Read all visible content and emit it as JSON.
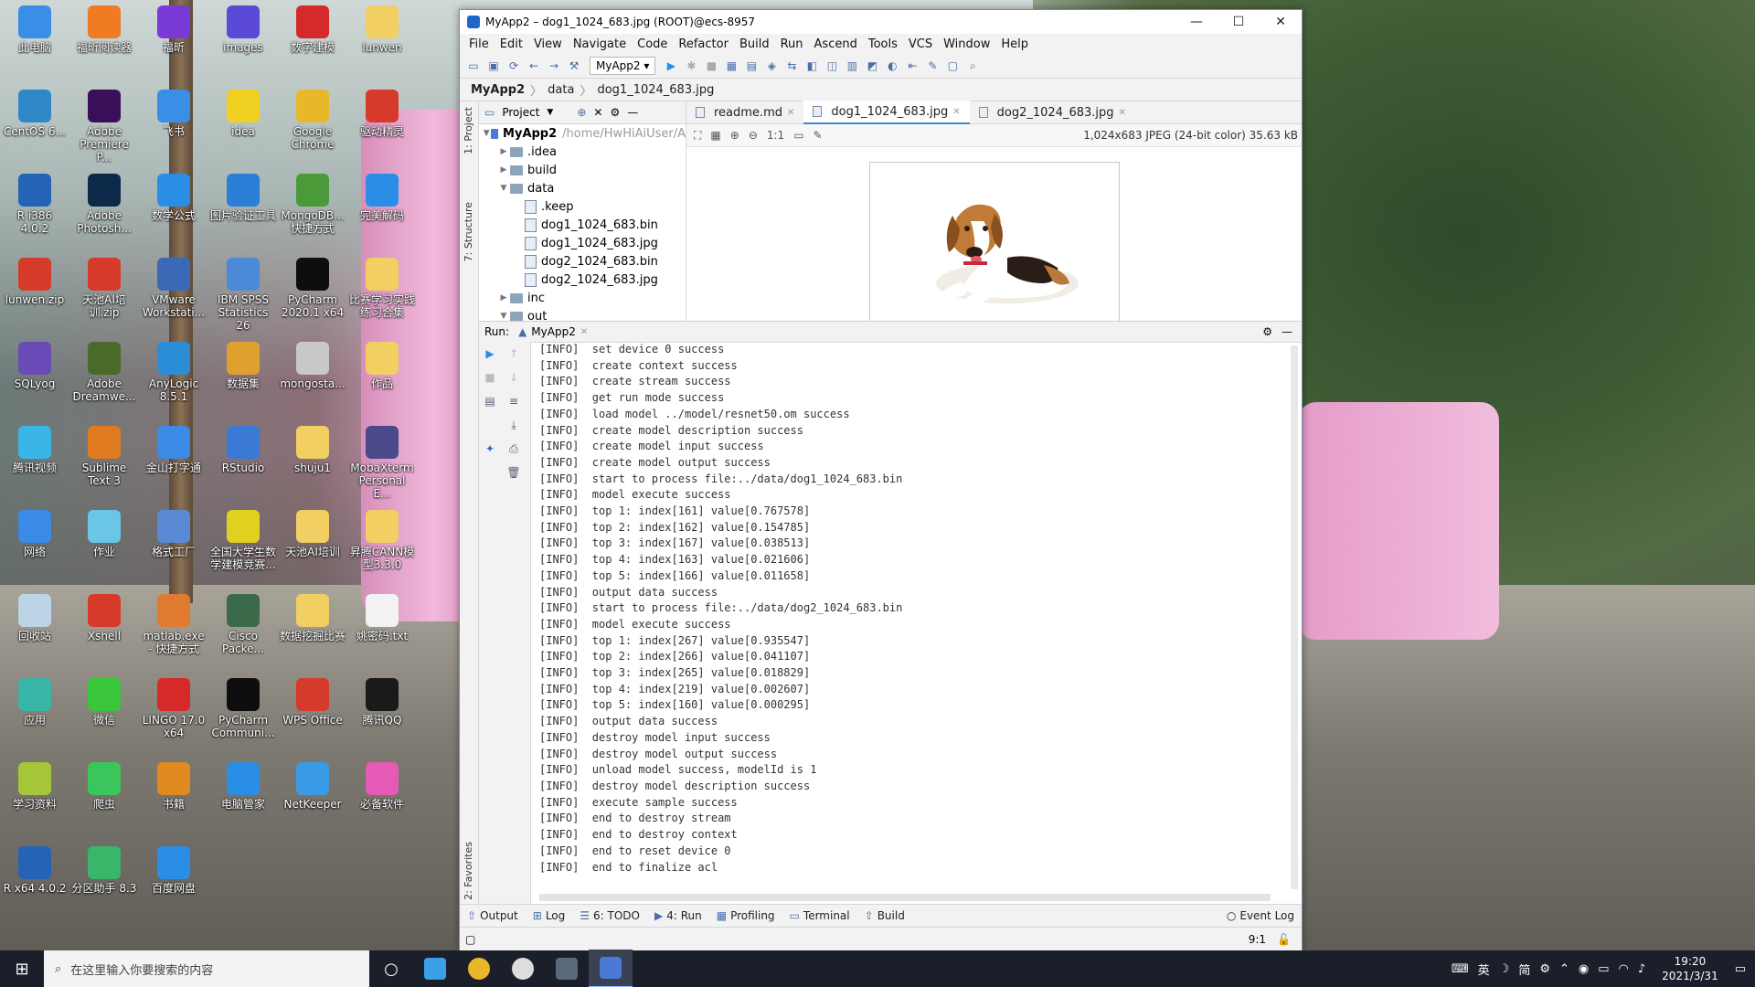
{
  "desktop_icons": [
    {
      "label": "此电脑",
      "color": "#3a8ee6"
    },
    {
      "label": "福昕阅读器",
      "color": "#f07b22"
    },
    {
      "label": "福昕",
      "color": "#7a3ad6"
    },
    {
      "label": "images",
      "color": "#5a4ad6"
    },
    {
      "label": "数字建模",
      "color": "#d62a2a"
    },
    {
      "label": "lunwen",
      "color": "#f2cf62"
    },
    {
      "label": "CentOS 6...",
      "color": "#2f89c9"
    },
    {
      "label": "Adobe Premiere P...",
      "color": "#3a0f5a"
    },
    {
      "label": "飞书",
      "color": "#3a8ee6"
    },
    {
      "label": "idea",
      "color": "#f0d020"
    },
    {
      "label": "Google Chrome",
      "color": "#e9b82a"
    },
    {
      "label": "驱动精灵",
      "color": "#d63a2a"
    },
    {
      "label": "R i386 4.0.2",
      "color": "#2463b5"
    },
    {
      "label": "Adobe Photosh...",
      "color": "#0d2a4a"
    },
    {
      "label": "数学公式",
      "color": "#2a8ee6"
    },
    {
      "label": "图片验证工具",
      "color": "#2a7ed6"
    },
    {
      "label": "MongoDB... 快捷方式",
      "color": "#4a9a3a"
    },
    {
      "label": "完美解码",
      "color": "#2a8ee6"
    },
    {
      "label": "lunwen.zip",
      "color": "#d63a2a"
    },
    {
      "label": "天池AI培训.zip",
      "color": "#d63a2a"
    },
    {
      "label": "VMware Workstati...",
      "color": "#3a6ab6"
    },
    {
      "label": "IBM SPSS Statistics 26",
      "color": "#4a8ad6"
    },
    {
      "label": "PyCharm 2020.1 x64",
      "color": "#0e0e0e"
    },
    {
      "label": "比赛学习实践练习合集",
      "color": "#f2cf62"
    },
    {
      "label": "SQLyog",
      "color": "#6a4ab6"
    },
    {
      "label": "Adobe Dreamwe...",
      "color": "#4a6a2a"
    },
    {
      "label": "AnyLogic 8.5.1",
      "color": "#2a8ed6"
    },
    {
      "label": "数据集",
      "color": "#e0a030"
    },
    {
      "label": "mongosta...",
      "color": "#c8c8c8"
    },
    {
      "label": "作品",
      "color": "#f2cf62"
    },
    {
      "label": "腾讯视频",
      "color": "#3ab6e6"
    },
    {
      "label": "Sublime Text 3",
      "color": "#e07a20"
    },
    {
      "label": "金山打字通",
      "color": "#3a8ae6"
    },
    {
      "label": "RStudio",
      "color": "#3a7ad6"
    },
    {
      "label": "shuju1",
      "color": "#f2cf62"
    },
    {
      "label": "MobaXterm Personal E...",
      "color": "#4a4a8a"
    },
    {
      "label": "网络",
      "color": "#3a8ae6"
    },
    {
      "label": "作业",
      "color": "#6ac6e6"
    },
    {
      "label": "格式工厂",
      "color": "#5a8ad6"
    },
    {
      "label": "全国大学生数学建模竞赛...",
      "color": "#e0d020"
    },
    {
      "label": "天池AI培训",
      "color": "#f2cf62"
    },
    {
      "label": "昇腾CANN模型3.3.0",
      "color": "#f2cf62"
    },
    {
      "label": "回收站",
      "color": "#bcd4e6"
    },
    {
      "label": "Xshell",
      "color": "#d63a2a"
    },
    {
      "label": "matlab.exe - 快捷方式",
      "color": "#e07a30"
    },
    {
      "label": "Cisco Packe...",
      "color": "#3a6a4a"
    },
    {
      "label": "数据挖掘比赛",
      "color": "#f2cf62"
    },
    {
      "label": "姚密码.txt",
      "color": "#f2f2f2"
    },
    {
      "label": "应用",
      "color": "#3ab6a6"
    },
    {
      "label": "微信",
      "color": "#3ac63a"
    },
    {
      "label": "LINGO 17.0 x64",
      "color": "#d62a2a"
    },
    {
      "label": "PyCharm Communi...",
      "color": "#0e0e0e"
    },
    {
      "label": "WPS Office",
      "color": "#d63a2a"
    },
    {
      "label": "腾讯QQ",
      "color": "#1a1a1a"
    },
    {
      "label": "学习资料",
      "color": "#a6c63a"
    },
    {
      "label": "爬虫",
      "color": "#3ac65a"
    },
    {
      "label": "书籍",
      "color": "#e08a20"
    },
    {
      "label": "电脑管家",
      "color": "#2a8ee6"
    },
    {
      "label": "NetKeeper",
      "color": "#3a9ae6"
    },
    {
      "label": "必备软件",
      "color": "#e65ab6"
    },
    {
      "label": "R x64 4.0.2",
      "color": "#2463b5"
    },
    {
      "label": "分区助手 8.3",
      "color": "#3ab66a"
    },
    {
      "label": "百度网盘",
      "color": "#2a8ee6"
    }
  ],
  "window": {
    "title": "MyApp2 – dog1_1024_683.jpg (ROOT)@ecs-8957",
    "minimize": "—",
    "maximize": "☐",
    "close": "✕"
  },
  "menu": [
    "File",
    "Edit",
    "View",
    "Navigate",
    "Code",
    "Refactor",
    "Build",
    "Run",
    "Ascend",
    "Tools",
    "VCS",
    "Window",
    "Help"
  ],
  "run_config": "MyApp2",
  "breadcrumb": [
    "MyApp2",
    "data",
    "dog1_1024_683.jpg"
  ],
  "project_panel": {
    "title": "Project",
    "tree": [
      {
        "label": "MyApp2",
        "extra": "/home/HwHiAiUser/A",
        "depth": 0,
        "kind": "root",
        "arrow": "▼"
      },
      {
        "label": ".idea",
        "depth": 1,
        "kind": "folder",
        "arrow": "▶"
      },
      {
        "label": "build",
        "depth": 1,
        "kind": "folder",
        "arrow": "▶"
      },
      {
        "label": "data",
        "depth": 1,
        "kind": "folder",
        "arrow": "▼"
      },
      {
        "label": ".keep",
        "depth": 2,
        "kind": "file",
        "arrow": ""
      },
      {
        "label": "dog1_1024_683.bin",
        "depth": 2,
        "kind": "file",
        "arrow": ""
      },
      {
        "label": "dog1_1024_683.jpg",
        "depth": 2,
        "kind": "file",
        "arrow": ""
      },
      {
        "label": "dog2_1024_683.bin",
        "depth": 2,
        "kind": "file",
        "arrow": ""
      },
      {
        "label": "dog2_1024_683.jpg",
        "depth": 2,
        "kind": "file",
        "arrow": ""
      },
      {
        "label": "inc",
        "depth": 1,
        "kind": "folder",
        "arrow": "▶"
      },
      {
        "label": "out",
        "depth": 1,
        "kind": "folder",
        "arrow": "▼"
      }
    ]
  },
  "left_strip": [
    "1: Project",
    "7: Structure",
    "2: Favorites"
  ],
  "tabs": [
    {
      "label": "readme.md",
      "active": false
    },
    {
      "label": "dog1_1024_683.jpg",
      "active": true
    },
    {
      "label": "dog2_1024_683.jpg",
      "active": false
    }
  ],
  "image_info": "1,024x683 JPEG (24-bit color) 35.63 kB",
  "zoom_label": "1:1",
  "run_panel": {
    "label": "Run:",
    "tab": "MyApp2",
    "lines": [
      "[INFO]  set device 0 success",
      "[INFO]  create context success",
      "[INFO]  create stream success",
      "[INFO]  get run mode success",
      "[INFO]  load model ../model/resnet50.om success",
      "[INFO]  create model description success",
      "[INFO]  create model input success",
      "[INFO]  create model output success",
      "[INFO]  start to process file:../data/dog1_1024_683.bin",
      "[INFO]  model execute success",
      "[INFO]  top 1: index[161] value[0.767578]",
      "[INFO]  top 2: index[162] value[0.154785]",
      "[INFO]  top 3: index[167] value[0.038513]",
      "[INFO]  top 4: index[163] value[0.021606]",
      "[INFO]  top 5: index[166] value[0.011658]",
      "[INFO]  output data success",
      "[INFO]  start to process file:../data/dog2_1024_683.bin",
      "[INFO]  model execute success",
      "[INFO]  top 1: index[267] value[0.935547]",
      "[INFO]  top 2: index[266] value[0.041107]",
      "[INFO]  top 3: index[265] value[0.018829]",
      "[INFO]  top 4: index[219] value[0.002607]",
      "[INFO]  top 5: index[160] value[0.000295]",
      "[INFO]  output data success",
      "[INFO]  destroy model input success",
      "[INFO]  destroy model output success",
      "[INFO]  unload model success, modelId is 1",
      "[INFO]  destroy model description success",
      "[INFO]  execute sample success",
      "[INFO]  end to destroy stream",
      "[INFO]  end to destroy context",
      "[INFO]  end to reset device 0",
      "[INFO]  end to finalize acl"
    ]
  },
  "bottom_tools": [
    {
      "label": "Output",
      "icon": "output-icon"
    },
    {
      "label": "Log",
      "icon": "log-icon"
    },
    {
      "label": "6: TODO",
      "icon": "todo-icon"
    },
    {
      "label": "4: Run",
      "icon": "run-icon"
    },
    {
      "label": "Profiling",
      "icon": "profiling-icon"
    },
    {
      "label": "Terminal",
      "icon": "terminal-icon"
    },
    {
      "label": "Build",
      "icon": "build-icon"
    }
  ],
  "event_log": "Event Log",
  "cursor_pos": "9:1",
  "taskbar": {
    "search_placeholder": "在这里输入你要搜索的内容",
    "tray_text": "英",
    "ime_text": "简",
    "time": "19:20",
    "date": "2021/3/31"
  }
}
